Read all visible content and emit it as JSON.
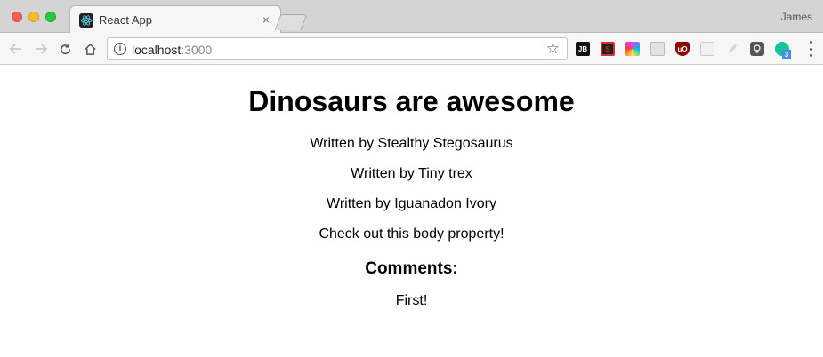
{
  "browser": {
    "tab": {
      "title": "React App",
      "close": "×"
    },
    "profile_name": "James",
    "address_bar": {
      "host": "localhost",
      "port": ":3000"
    },
    "extensions": [
      {
        "name": "jb-extension-icon",
        "label": "JB",
        "color": "#111111"
      },
      {
        "name": "s-extension-icon",
        "label": "S",
        "color": "#d32f2f"
      },
      {
        "name": "color-extension-icon",
        "label": "",
        "color": "#e040fb"
      },
      {
        "name": "gray-extension-icon",
        "label": "",
        "color": "#cfcfcf"
      },
      {
        "name": "ublock-extension-icon",
        "label": "uO",
        "color": "#8b0000"
      },
      {
        "name": "outline-extension-icon",
        "label": "",
        "color": "#dddddd"
      },
      {
        "name": "feather-extension-icon",
        "label": "",
        "color": "#dddddd"
      },
      {
        "name": "bulb-extension-icon",
        "label": "",
        "color": "#555555"
      },
      {
        "name": "grammarly-extension-icon",
        "label": "3",
        "color": "#15c39a"
      }
    ]
  },
  "page": {
    "title": "Dinosaurs are awesome",
    "authors": [
      "Written by Stealthy Stegosaurus",
      "Written by Tiny trex",
      "Written by Iguanadon Ivory"
    ],
    "body": "Check out this body property!",
    "comments_heading": "Comments:",
    "comments": [
      "First!"
    ]
  }
}
